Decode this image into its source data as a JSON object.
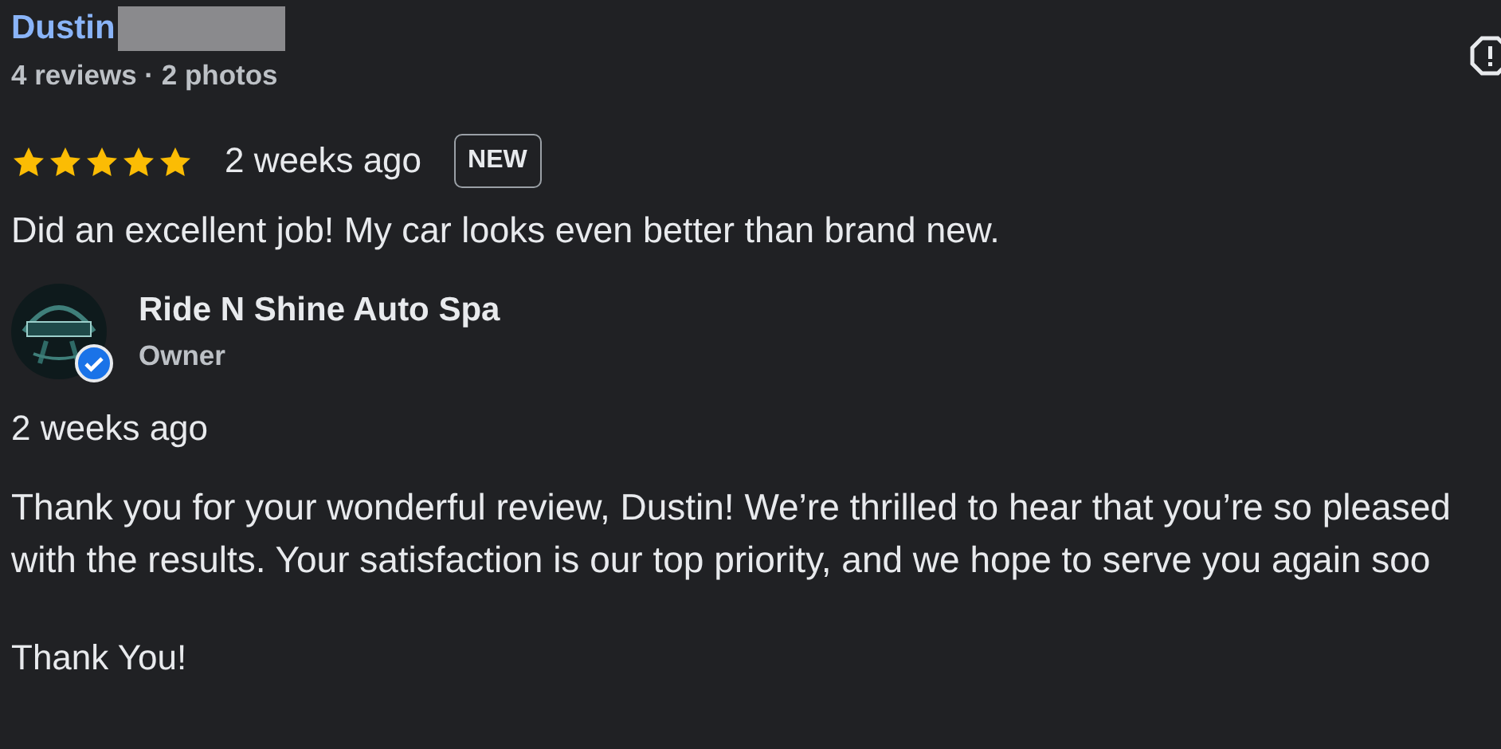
{
  "review": {
    "author": "Dustin",
    "meta": "4 reviews · 2 photos",
    "stars": 5,
    "time": "2 weeks ago",
    "badge": "NEW",
    "text": "Did an excellent job! My car looks even better than brand new."
  },
  "owner_reply": {
    "name": "Ride N Shine Auto Spa",
    "role": "Owner",
    "verified": true,
    "time": "2 weeks ago",
    "lines": [
      "Thank you for your wonderful review, Dustin! We’re thrilled to hear that you’re so pleased",
      "with the results. Your satisfaction is our top priority, and we hope to serve you again soo"
    ],
    "closing": "Thank You!"
  }
}
